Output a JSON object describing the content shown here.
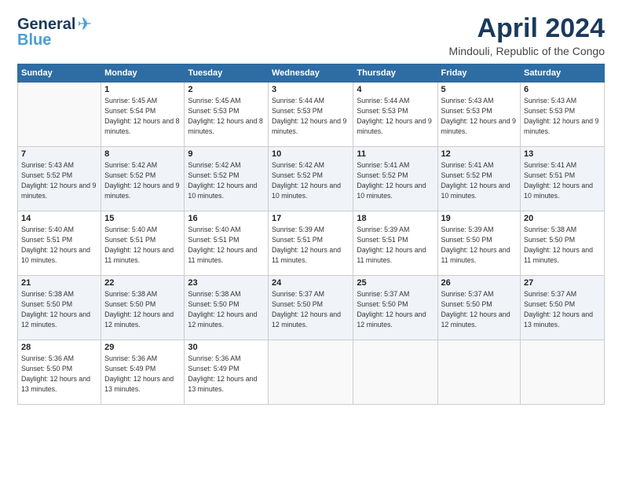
{
  "header": {
    "logo_line1": "General",
    "logo_line2": "Blue",
    "month": "April 2024",
    "location": "Mindouli, Republic of the Congo"
  },
  "weekdays": [
    "Sunday",
    "Monday",
    "Tuesday",
    "Wednesday",
    "Thursday",
    "Friday",
    "Saturday"
  ],
  "weeks": [
    [
      {
        "day": "",
        "empty": true
      },
      {
        "day": "1",
        "sunrise": "5:45 AM",
        "sunset": "5:54 PM",
        "daylight": "12 hours and 8 minutes."
      },
      {
        "day": "2",
        "sunrise": "5:45 AM",
        "sunset": "5:53 PM",
        "daylight": "12 hours and 8 minutes."
      },
      {
        "day": "3",
        "sunrise": "5:44 AM",
        "sunset": "5:53 PM",
        "daylight": "12 hours and 9 minutes."
      },
      {
        "day": "4",
        "sunrise": "5:44 AM",
        "sunset": "5:53 PM",
        "daylight": "12 hours and 9 minutes."
      },
      {
        "day": "5",
        "sunrise": "5:43 AM",
        "sunset": "5:53 PM",
        "daylight": "12 hours and 9 minutes."
      },
      {
        "day": "6",
        "sunrise": "5:43 AM",
        "sunset": "5:53 PM",
        "daylight": "12 hours and 9 minutes."
      }
    ],
    [
      {
        "day": "7",
        "sunrise": "5:43 AM",
        "sunset": "5:52 PM",
        "daylight": "12 hours and 9 minutes."
      },
      {
        "day": "8",
        "sunrise": "5:42 AM",
        "sunset": "5:52 PM",
        "daylight": "12 hours and 9 minutes."
      },
      {
        "day": "9",
        "sunrise": "5:42 AM",
        "sunset": "5:52 PM",
        "daylight": "12 hours and 10 minutes."
      },
      {
        "day": "10",
        "sunrise": "5:42 AM",
        "sunset": "5:52 PM",
        "daylight": "12 hours and 10 minutes."
      },
      {
        "day": "11",
        "sunrise": "5:41 AM",
        "sunset": "5:52 PM",
        "daylight": "12 hours and 10 minutes."
      },
      {
        "day": "12",
        "sunrise": "5:41 AM",
        "sunset": "5:52 PM",
        "daylight": "12 hours and 10 minutes."
      },
      {
        "day": "13",
        "sunrise": "5:41 AM",
        "sunset": "5:51 PM",
        "daylight": "12 hours and 10 minutes."
      }
    ],
    [
      {
        "day": "14",
        "sunrise": "5:40 AM",
        "sunset": "5:51 PM",
        "daylight": "12 hours and 10 minutes."
      },
      {
        "day": "15",
        "sunrise": "5:40 AM",
        "sunset": "5:51 PM",
        "daylight": "12 hours and 11 minutes."
      },
      {
        "day": "16",
        "sunrise": "5:40 AM",
        "sunset": "5:51 PM",
        "daylight": "12 hours and 11 minutes."
      },
      {
        "day": "17",
        "sunrise": "5:39 AM",
        "sunset": "5:51 PM",
        "daylight": "12 hours and 11 minutes."
      },
      {
        "day": "18",
        "sunrise": "5:39 AM",
        "sunset": "5:51 PM",
        "daylight": "12 hours and 11 minutes."
      },
      {
        "day": "19",
        "sunrise": "5:39 AM",
        "sunset": "5:50 PM",
        "daylight": "12 hours and 11 minutes."
      },
      {
        "day": "20",
        "sunrise": "5:38 AM",
        "sunset": "5:50 PM",
        "daylight": "12 hours and 11 minutes."
      }
    ],
    [
      {
        "day": "21",
        "sunrise": "5:38 AM",
        "sunset": "5:50 PM",
        "daylight": "12 hours and 12 minutes."
      },
      {
        "day": "22",
        "sunrise": "5:38 AM",
        "sunset": "5:50 PM",
        "daylight": "12 hours and 12 minutes."
      },
      {
        "day": "23",
        "sunrise": "5:38 AM",
        "sunset": "5:50 PM",
        "daylight": "12 hours and 12 minutes."
      },
      {
        "day": "24",
        "sunrise": "5:37 AM",
        "sunset": "5:50 PM",
        "daylight": "12 hours and 12 minutes."
      },
      {
        "day": "25",
        "sunrise": "5:37 AM",
        "sunset": "5:50 PM",
        "daylight": "12 hours and 12 minutes."
      },
      {
        "day": "26",
        "sunrise": "5:37 AM",
        "sunset": "5:50 PM",
        "daylight": "12 hours and 12 minutes."
      },
      {
        "day": "27",
        "sunrise": "5:37 AM",
        "sunset": "5:50 PM",
        "daylight": "12 hours and 13 minutes."
      }
    ],
    [
      {
        "day": "28",
        "sunrise": "5:36 AM",
        "sunset": "5:50 PM",
        "daylight": "12 hours and 13 minutes."
      },
      {
        "day": "29",
        "sunrise": "5:36 AM",
        "sunset": "5:49 PM",
        "daylight": "12 hours and 13 minutes."
      },
      {
        "day": "30",
        "sunrise": "5:36 AM",
        "sunset": "5:49 PM",
        "daylight": "12 hours and 13 minutes."
      },
      {
        "day": "",
        "empty": true
      },
      {
        "day": "",
        "empty": true
      },
      {
        "day": "",
        "empty": true
      },
      {
        "day": "",
        "empty": true
      }
    ]
  ],
  "labels": {
    "sunrise": "Sunrise:",
    "sunset": "Sunset:",
    "daylight": "Daylight:"
  }
}
